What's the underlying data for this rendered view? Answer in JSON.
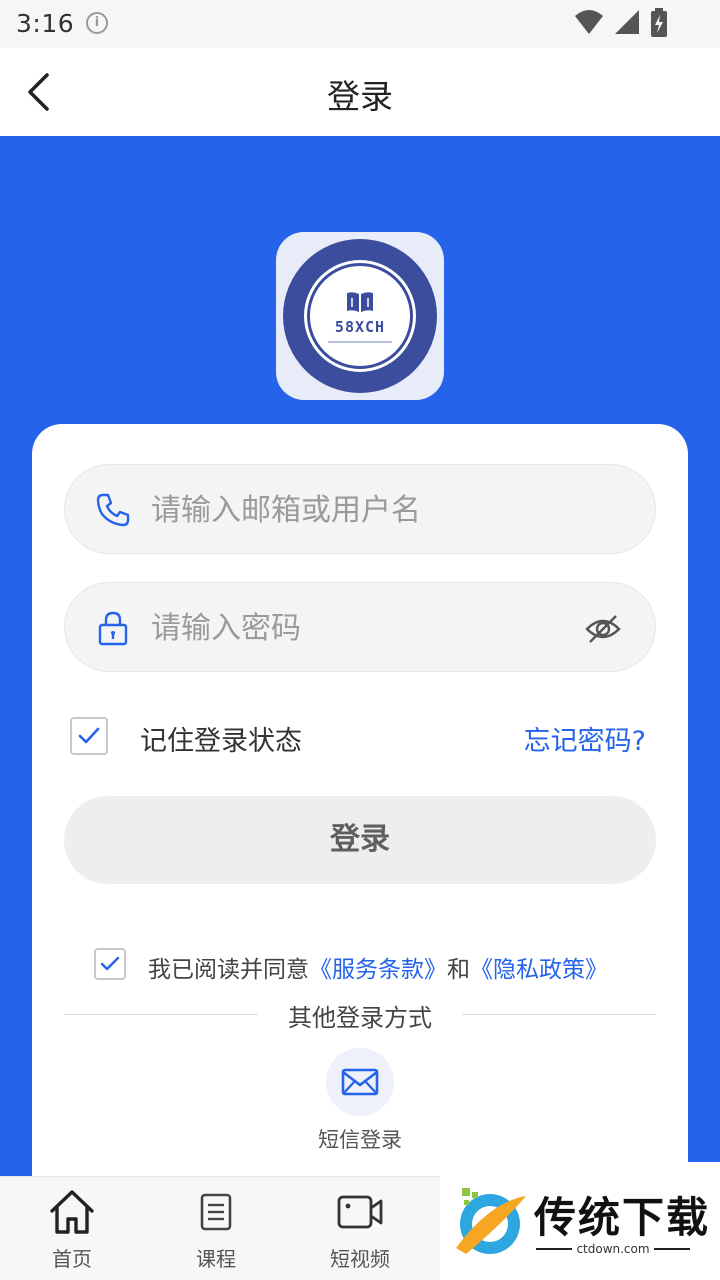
{
  "status_bar": {
    "time": "3:16",
    "info_icon": "i"
  },
  "header": {
    "title": "登录"
  },
  "logo": {
    "text": "58XCH"
  },
  "form": {
    "username_placeholder": "请输入邮箱或用户名",
    "password_placeholder": "请输入密码",
    "remember_label": "记住登录状态",
    "remember_checked": true,
    "forgot_label": "忘记密码?",
    "login_button": "登录"
  },
  "agreement": {
    "checked": true,
    "prefix": "我已阅读并同意",
    "terms": "《服务条款》",
    "conjunction": "和",
    "privacy": "《隐私政策》"
  },
  "other_login": {
    "title": "其他登录方式",
    "sms_label": "短信登录"
  },
  "bottom_nav": {
    "items": [
      {
        "label": "首页",
        "icon": "home-icon"
      },
      {
        "label": "课程",
        "icon": "document-icon"
      },
      {
        "label": "短视频",
        "icon": "video-icon"
      }
    ]
  },
  "watermark": {
    "title": "传统下载",
    "url": "ctdown.com"
  },
  "colors": {
    "primary": "#2563eb",
    "button_bg": "#eeeeee",
    "field_bg": "#f4f4f4"
  }
}
